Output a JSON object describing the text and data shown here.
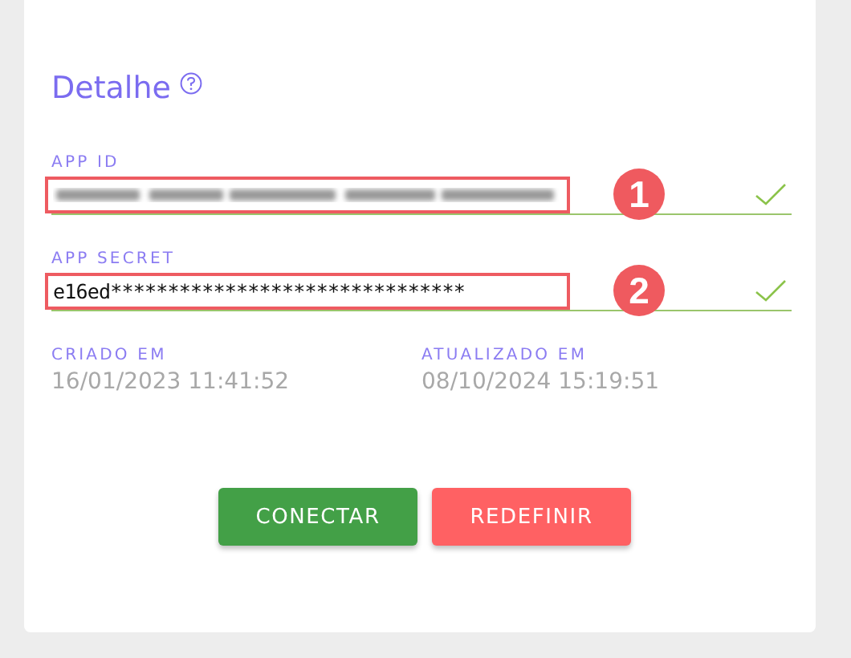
{
  "card": {
    "title": "Detalhe",
    "fields": [
      {
        "label": "APP ID",
        "kind": "blurred",
        "annotation": "1",
        "valid": true
      },
      {
        "label": "APP SECRET",
        "kind": "text",
        "value": "e16ed*******************************",
        "annotation": "2",
        "valid": true
      }
    ],
    "dates": [
      {
        "label": "CRIADO EM",
        "value": "16/01/2023 11:41:52"
      },
      {
        "label": "ATUALIZADO EM",
        "value": "08/10/2024 15:19:51"
      }
    ],
    "buttons": [
      {
        "label": "CONECTAR",
        "kind": "primary"
      },
      {
        "label": "REDEFINIR",
        "kind": "danger"
      }
    ]
  }
}
